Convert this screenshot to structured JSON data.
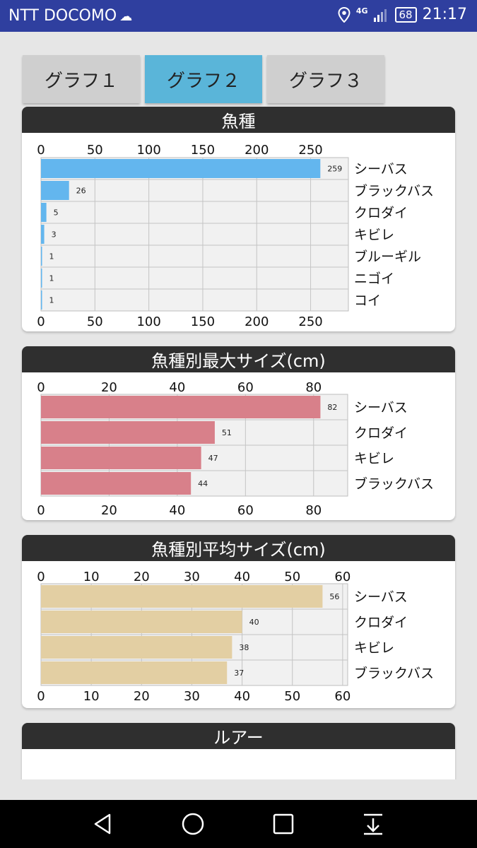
{
  "status_bar": {
    "carrier": "NTT DOCOMO",
    "network": "4G",
    "battery": "68",
    "time": "21:17"
  },
  "tabs": [
    {
      "label": "グラフ１",
      "active": false
    },
    {
      "label": "グラフ２",
      "active": true
    },
    {
      "label": "グラフ３",
      "active": false
    }
  ],
  "colors": {
    "status_bar": "#2f3f9f",
    "tab_active": "#5ab5d9",
    "tab_inactive": "#cfcfcf",
    "card_header": "#2f2f2f"
  },
  "chart_data": [
    {
      "type": "bar",
      "orientation": "horizontal",
      "title": "魚種",
      "categories": [
        "シーバス",
        "ブラックバス",
        "クロダイ",
        "キビレ",
        "ブルーギル",
        "ニゴイ",
        "コイ"
      ],
      "values": [
        259,
        26,
        5,
        3,
        1,
        1,
        1
      ],
      "xlim": [
        0,
        285
      ],
      "xticks": [
        0,
        50,
        100,
        150,
        200,
        250
      ],
      "color": "#63b6ee",
      "grid": true
    },
    {
      "type": "bar",
      "orientation": "horizontal",
      "title": "魚種別最大サイズ(cm)",
      "categories": [
        "シーバス",
        "クロダイ",
        "キビレ",
        "ブラックバス"
      ],
      "values": [
        82,
        51,
        47,
        44
      ],
      "xlim": [
        0,
        90
      ],
      "xticks": [
        0,
        20,
        40,
        60,
        80
      ],
      "color": "#d8808a",
      "grid": true
    },
    {
      "type": "bar",
      "orientation": "horizontal",
      "title": "魚種別平均サイズ(cm)",
      "categories": [
        "シーバス",
        "クロダイ",
        "キビレ",
        "ブラックバス"
      ],
      "values": [
        56,
        40,
        38,
        37
      ],
      "xlim": [
        0,
        61
      ],
      "xticks": [
        0,
        10,
        20,
        30,
        40,
        50,
        60
      ],
      "color": "#e3cfa3",
      "grid": true
    },
    {
      "type": "bar",
      "orientation": "horizontal",
      "title": "ルアー",
      "xticks": [
        0,
        10,
        20,
        30,
        40,
        50
      ],
      "xlim": [
        0,
        57
      ],
      "color": "#f3dc4a",
      "grid": true
    }
  ]
}
